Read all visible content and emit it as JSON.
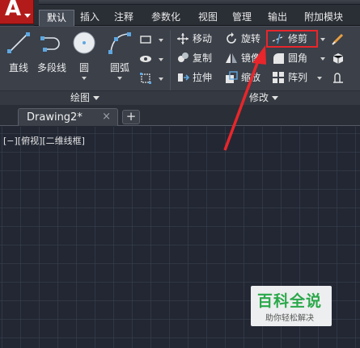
{
  "app": {
    "logo_letter": "A"
  },
  "ribbon_tabs": [
    {
      "label": "默认",
      "active": true
    },
    {
      "label": "插入"
    },
    {
      "label": "注释"
    },
    {
      "label": "参数化"
    },
    {
      "label": "视图"
    },
    {
      "label": "管理"
    },
    {
      "label": "输出"
    },
    {
      "label": "附加模块"
    }
  ],
  "draw_panel": {
    "title": "绘图",
    "tools": [
      {
        "label": "直线",
        "icon": "line-icon"
      },
      {
        "label": "多段线",
        "icon": "polyline-icon"
      },
      {
        "label": "圆",
        "icon": "circle-icon"
      },
      {
        "label": "圆弧",
        "icon": "arc-icon"
      }
    ]
  },
  "modify_panel": {
    "title": "修改",
    "tools": {
      "move": "移动",
      "rotate": "旋转",
      "trim": "修剪",
      "copy": "复制",
      "mirror": "镜像",
      "fillet": "圆角",
      "stretch": "拉伸",
      "scale": "缩放",
      "array": "阵列"
    }
  },
  "file_tab": {
    "name": "Drawing2*",
    "close": "×",
    "new": "+"
  },
  "viewport_label": "[−][俯视][二维线框]",
  "watermark": {
    "title": "百科全说",
    "subtitle": "助你轻松解决"
  },
  "colors": {
    "highlight": "#e8262b",
    "canvas": "#222733",
    "app_button": "#b31b1b",
    "watermark_green": "#2aa84a"
  }
}
